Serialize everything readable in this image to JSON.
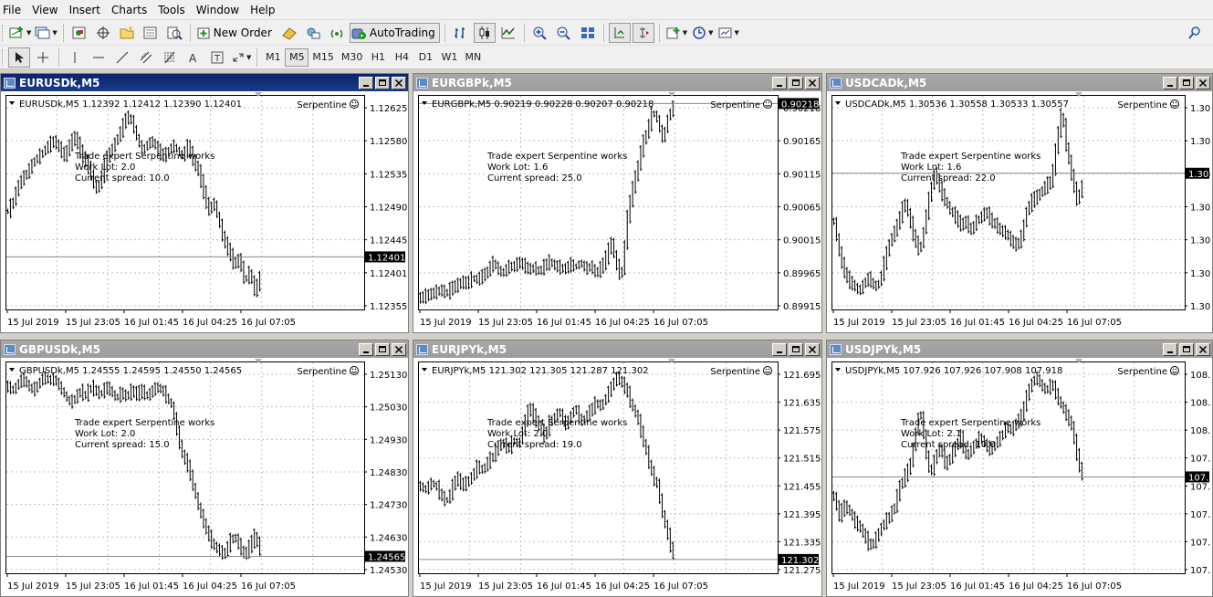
{
  "menu": [
    "File",
    "View",
    "Insert",
    "Charts",
    "Tools",
    "Window",
    "Help"
  ],
  "toolbar": {
    "new_order_label": "New Order",
    "autotrading_label": "AutoTrading"
  },
  "timeframes": [
    "M1",
    "M5",
    "M15",
    "M30",
    "H1",
    "H4",
    "D1",
    "W1",
    "MN"
  ],
  "active_timeframe": "M5",
  "expert_name": "Serpentine",
  "colors": {
    "active_title": "#0a246a",
    "inactive_title": "#9c9c9c",
    "candles": "#000000",
    "grid": "#c0c0c0",
    "price_tag_bg": "#000000"
  },
  "charts": [
    {
      "title": "EURUSDk,M5",
      "active": true,
      "info": "EURUSDk,M5  1.12392 1.12412 1.12390 1.12401",
      "comment": [
        "Trade expert Serpentine works",
        "Work Lot: 2.0",
        "Current spread: 10.0"
      ],
      "price_labels": [
        "1.12625",
        "1.12580",
        "1.12535",
        "1.12490",
        "1.12445",
        "1.12401",
        "1.12355"
      ],
      "current_price": "1.12401",
      "time_labels": [
        "15 Jul 2019",
        "15 Jul 23:05",
        "16 Jul 01:45",
        "16 Jul 04:25",
        "16 Jul 07:05"
      ]
    },
    {
      "title": "EURGBPk,M5",
      "active": false,
      "info": "EURGBPk,M5  0.90219 0.90228 0.90207 0.90218",
      "comment": [
        "Trade expert Serpentine works",
        "Work Lot: 1.6",
        "Current spread: 25.0"
      ],
      "price_labels": [
        "0.90218",
        "0.90165",
        "0.90115",
        "0.90065",
        "0.90015",
        "0.89965",
        "0.89915"
      ],
      "current_price": "0.90218",
      "time_labels": [
        "15 Jul 2019",
        "15 Jul 23:05",
        "16 Jul 01:45",
        "16 Jul 04:25",
        "16 Jul 07:05"
      ]
    },
    {
      "title": "USDCADk,M5",
      "active": false,
      "info": "USDCADk,M5  1.30536 1.30558 1.30533 1.30557",
      "comment": [
        "Trade expert Serpentine works",
        "Work Lot: 1.6",
        "Current spread: 22.0"
      ],
      "price_labels": [
        "1.30",
        "1.30",
        "1.30",
        "1.30",
        "1.30",
        "1.30",
        "1.30"
      ],
      "current_price": "1.30",
      "time_labels": [
        "15 Jul 2019",
        "15 Jul 23:05",
        "16 Jul 01:45",
        "16 Jul 04:25",
        "16 Jul 07:05"
      ]
    },
    {
      "title": "GBPUSDk,M5",
      "active": false,
      "info": "GBPUSDk,M5  1.24555 1.24595 1.24550 1.24565",
      "comment": [
        "Trade expert Serpentine works",
        "Work Lot: 2.0",
        "Current spread: 15.0"
      ],
      "price_labels": [
        "1.25130",
        "1.25030",
        "1.24930",
        "1.24830",
        "1.24730",
        "1.24630",
        "1.24530"
      ],
      "current_price": "1.24565",
      "time_labels": [
        "15 Jul 2019",
        "15 Jul 23:05",
        "16 Jul 01:45",
        "16 Jul 04:25",
        "16 Jul 07:05"
      ]
    },
    {
      "title": "EURJPYk,M5",
      "active": false,
      "info": "EURJPYk,M5  121.302 121.305 121.287 121.302",
      "comment": [
        "Trade expert Serpentine works",
        "Work Lot: 2.0",
        "Current spread: 19.0"
      ],
      "price_labels": [
        "121.695",
        "121.635",
        "121.575",
        "121.515",
        "121.455",
        "121.395",
        "121.335",
        "121.275"
      ],
      "current_price": "121.302",
      "time_labels": [
        "15 Jul 2019",
        "15 Jul 23:05",
        "16 Jul 01:45",
        "16 Jul 04:25",
        "16 Jul 07:05"
      ]
    },
    {
      "title": "USDJPYk,M5",
      "active": false,
      "info": "USDJPYk,M5  107.926 107.926 107.908 107.918",
      "comment": [
        "Trade expert Serpentine works",
        "Work Lot: 2.1",
        "Current spread: 10.0"
      ],
      "price_labels": [
        "108.",
        "108.",
        "108.",
        "107.",
        "107.",
        "107.",
        "107.",
        "107."
      ],
      "current_price": "107.",
      "time_labels": [
        "15 Jul 2019",
        "15 Jul 23:05",
        "16 Jul 01:45",
        "16 Jul 04:25",
        "16 Jul 07:05"
      ]
    }
  ]
}
